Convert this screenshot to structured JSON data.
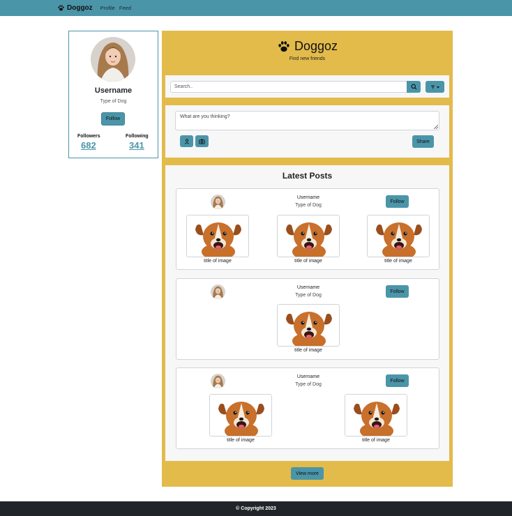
{
  "navbar": {
    "brand": "Doggoz",
    "links": [
      "Profile",
      "Feed"
    ]
  },
  "profile": {
    "username": "Username",
    "dog_type": "Type of Dog",
    "follow_label": "Follow",
    "followers_label": "Followers",
    "followers_count": "682",
    "following_label": "Following",
    "following_count": "341"
  },
  "header": {
    "title": "Doggoz",
    "subtitle": "Find new friends"
  },
  "search": {
    "placeholder": "Search.."
  },
  "compose": {
    "placeholder": "What are you thinking?",
    "share_label": "Share"
  },
  "feed": {
    "title": "Latest Posts",
    "posts": [
      {
        "username": "Username",
        "dog_type": "Type of Dog",
        "follow_label": "Follow",
        "images": [
          "title of image",
          "title of image",
          "title of image"
        ]
      },
      {
        "username": "Username",
        "dog_type": "Type of Dog",
        "follow_label": "Follow",
        "images": [
          "title of image"
        ]
      },
      {
        "username": "Username",
        "dog_type": "Type of Dog",
        "follow_label": "Follow",
        "images": [
          "title of image",
          "title of image"
        ]
      }
    ],
    "view_more_label": "View more"
  },
  "footer": {
    "text": "© Copyright 2023"
  },
  "colors": {
    "navbar": "#4b95a9",
    "accent": "#4b95a9",
    "panel": "#e2bb4b",
    "footer": "#212529"
  },
  "icons": [
    "paw-icon",
    "search-icon",
    "filter-icon",
    "user-icon",
    "camera-icon"
  ]
}
